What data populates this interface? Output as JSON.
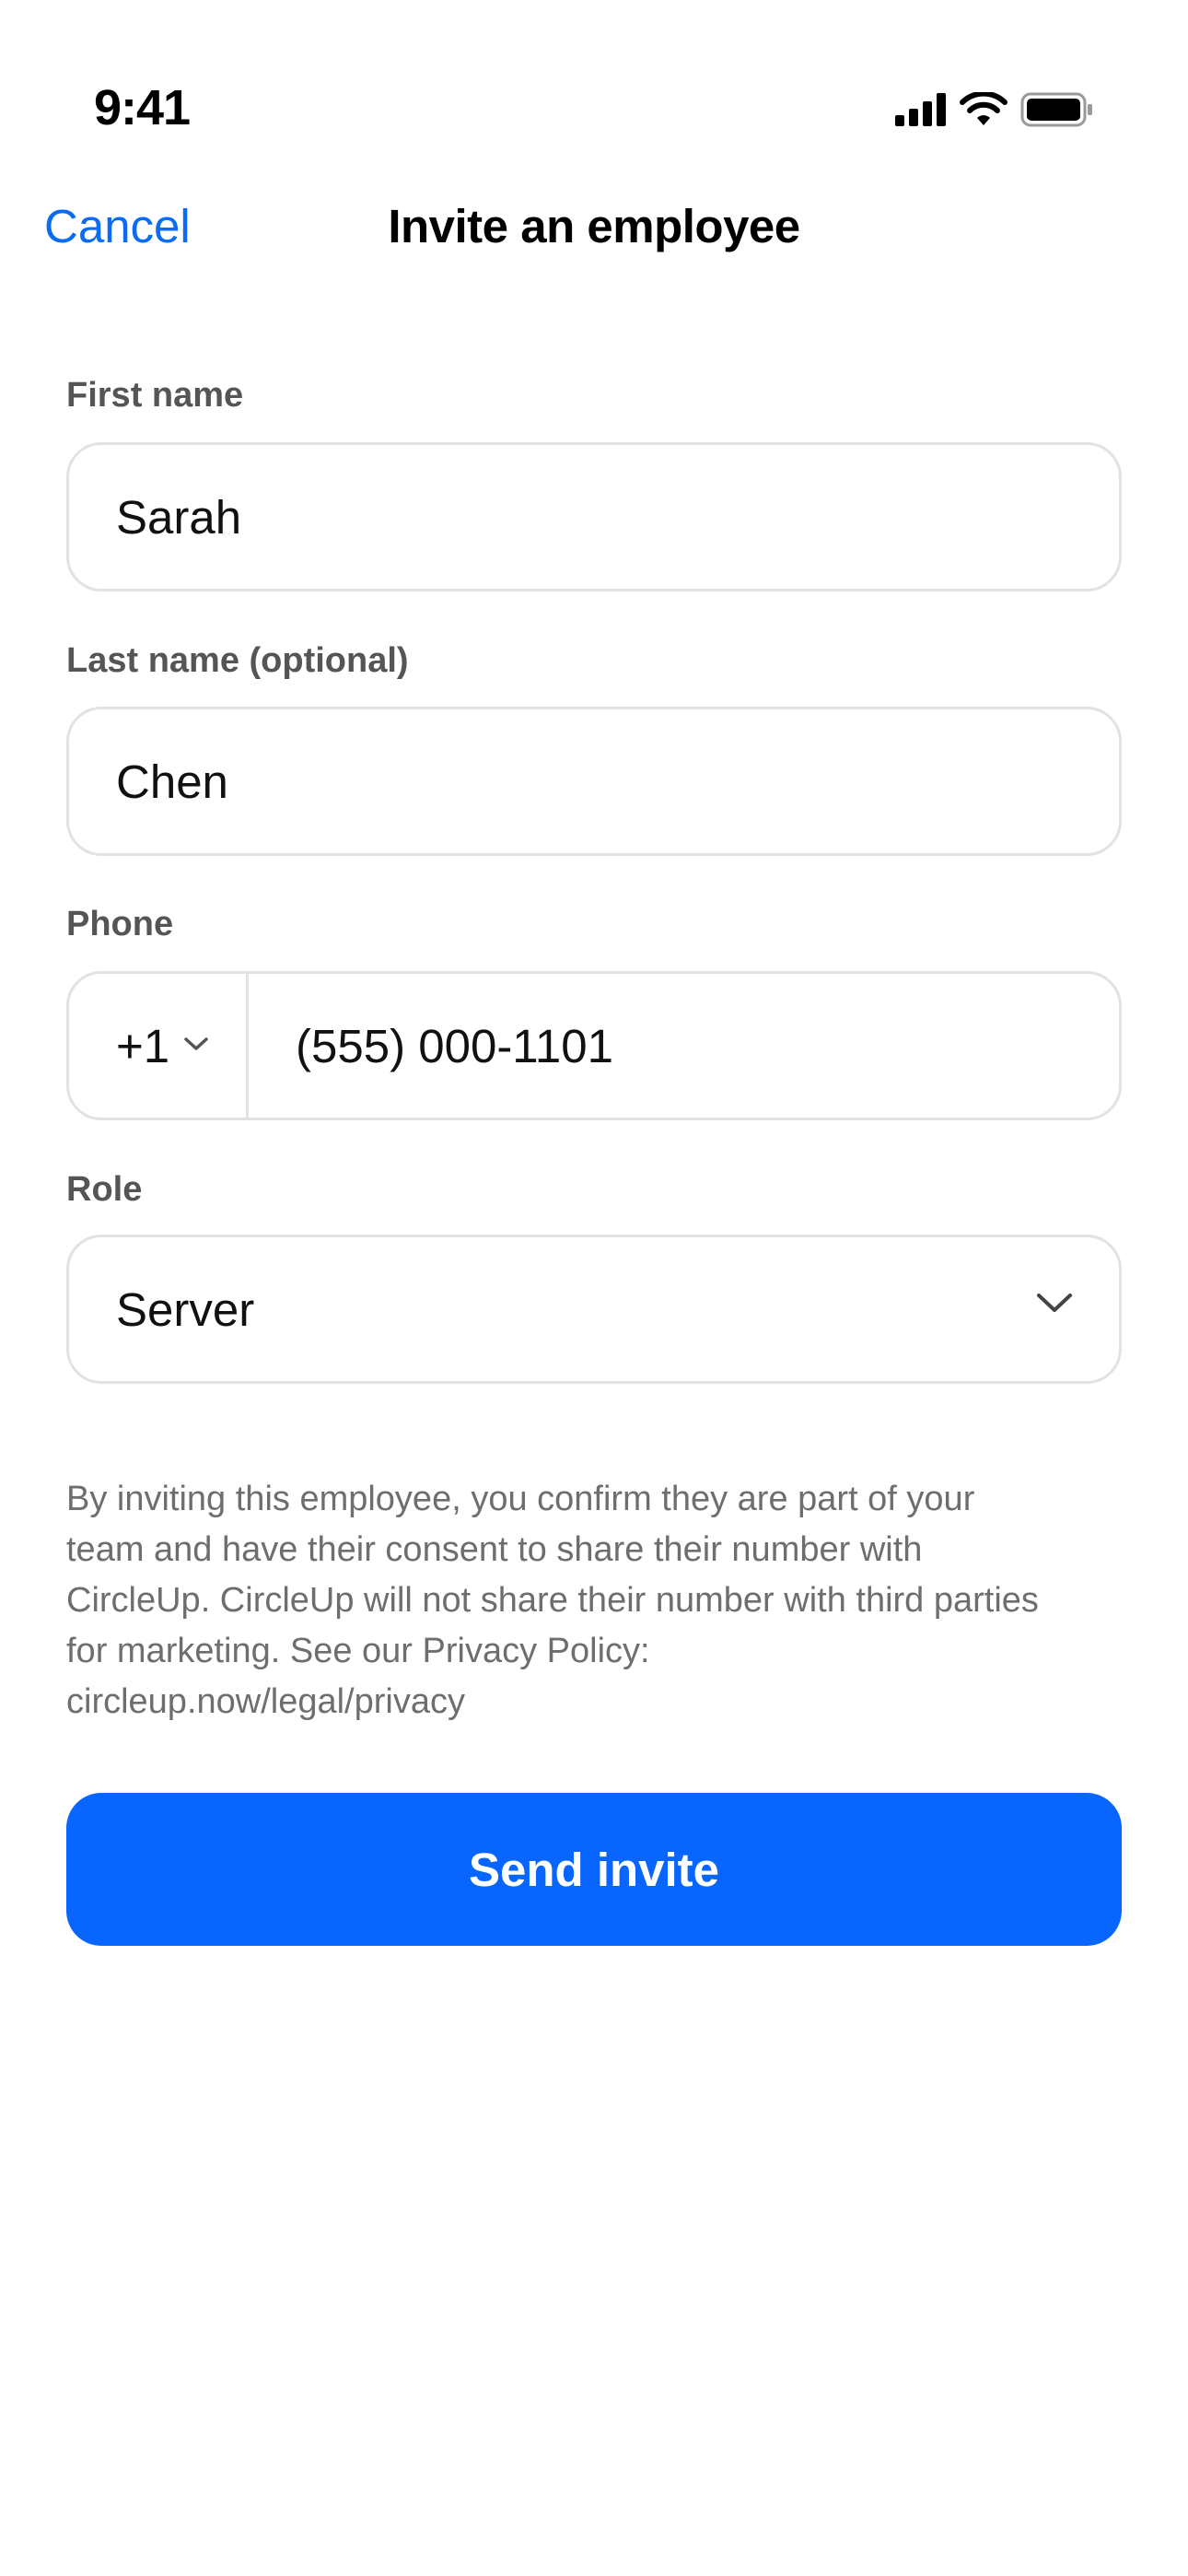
{
  "status_bar": {
    "time": "9:41",
    "icons": [
      "cellular-signal-icon",
      "wifi-icon",
      "battery-icon"
    ]
  },
  "nav": {
    "cancel_label": "Cancel",
    "title": "Invite an employee"
  },
  "form": {
    "first_name": {
      "label": "First name",
      "value": "Sarah"
    },
    "last_name": {
      "label": "Last name (optional)",
      "value": "Chen"
    },
    "phone": {
      "label": "Phone",
      "country_code": "+1",
      "number": "(555) 000-1101"
    },
    "role": {
      "label": "Role",
      "selected": "Server"
    }
  },
  "disclaimer": "By inviting this employee, you confirm they are part of your team and have their consent to share their number with CircleUp. CircleUp will not share their number with third parties for marketing. See our Privacy Policy: circleup.now/legal/privacy",
  "send_button_label": "Send invite",
  "colors": {
    "accent": "#0866ff",
    "link": "#0a6cf0",
    "label": "#555555",
    "border": "#e2e2e2",
    "muted_text": "#6e6e6e"
  }
}
